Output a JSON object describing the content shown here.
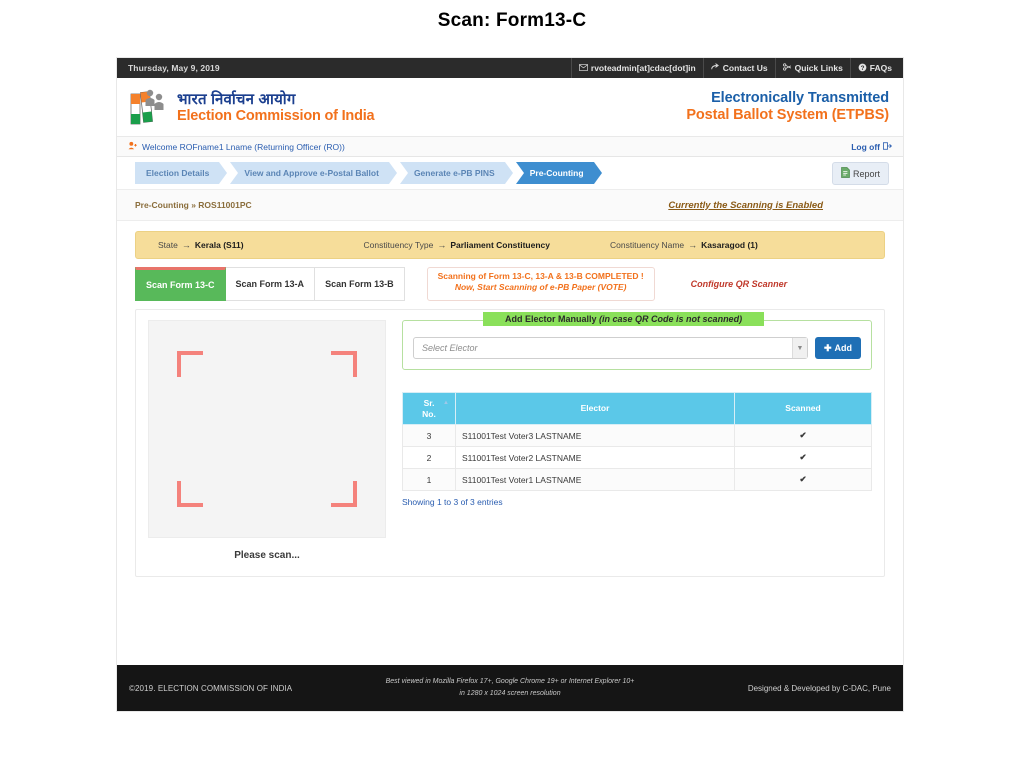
{
  "slide": {
    "title": "Scan: Form13-C"
  },
  "topbar": {
    "date": "Thursday, May 9, 2019",
    "links": [
      {
        "icon": "envelope-icon",
        "glyph": "✉",
        "label": "rvoteadmin[at]cdac[dot]in"
      },
      {
        "icon": "share-icon",
        "glyph": "↱",
        "label": "Contact Us"
      },
      {
        "icon": "link-icon",
        "glyph": "✂",
        "label": "Quick Links"
      },
      {
        "icon": "question-circle-icon",
        "glyph": "@",
        "label": "FAQs"
      }
    ]
  },
  "brand": {
    "hindi": "भारत निर्वाचन आयोग",
    "english": "Election Commission of India",
    "right_line1": "Electronically Transmitted",
    "right_line2": "Postal Ballot System (ETPBS)",
    "logo_icon": "eci-voter-logo-icon"
  },
  "welcome": {
    "user_icon": "user-plus-icon",
    "text": "Welcome ROFname1 Lname (Returning Officer (RO))",
    "logoff_label": "Log off",
    "logoff_icon": "logout-icon"
  },
  "nav": {
    "steps": [
      {
        "label": "Election Details",
        "active": false
      },
      {
        "label": "View and Approve e-Postal Ballot",
        "active": false
      },
      {
        "label": "Generate e-PB PINS",
        "active": false
      },
      {
        "label": "Pre-Counting",
        "active": true
      }
    ],
    "report_label": "Report",
    "report_icon": "document-icon"
  },
  "breadcrumb": {
    "text": "Pre-Counting » ROS11001PC",
    "scan_status": "Currently the Scanning is Enabled"
  },
  "constituency_bar": {
    "state_label": "State",
    "state_value": "Kerala  (S11)",
    "type_label": "Constituency Type",
    "type_value": "Parliament Constituency",
    "name_label": "Constituency Name",
    "name_value": "Kasaragod  (1)",
    "arrow": "→",
    "bg_color": "#f6dd9a"
  },
  "tabs": [
    {
      "label": "Scan Form 13-C",
      "active": true
    },
    {
      "label": "Scan Form 13-A",
      "active": false
    },
    {
      "label": "Scan Form 13-B",
      "active": false
    }
  ],
  "status_message": {
    "line1": "Scanning of Form 13-C, 13-A & 13-B COMPLETED !",
    "line2": "Now, Start Scanning of e-PB Paper (VOTE)",
    "color": "#f2711c"
  },
  "configure_qr": {
    "label": "Configure QR Scanner",
    "color": "#c0392b"
  },
  "scanner": {
    "placeholder_text": "Please scan...",
    "frame_icon": "scan-frame-icon",
    "frame_color": "#f4827c"
  },
  "add_elector": {
    "header_plain": "Add Elector Manually ",
    "header_italic": "(in case QR Code is not scanned)",
    "header_bg": "#8ae05a",
    "select_value": "Select Elector",
    "select_placeholder": "Select Elector",
    "caret_icon": "chevron-down-icon",
    "add_label": "Add",
    "add_icon": "plus-icon",
    "add_color": "#1f6fb5"
  },
  "table": {
    "columns": [
      "Sr. No.",
      "Elector",
      "Scanned"
    ],
    "col_srno_line1": "Sr.",
    "col_srno_line2": "No.",
    "col_elector": "Elector",
    "col_scanned": "Scanned",
    "sort_icon": "sort-asc-icon",
    "header_bg": "#5bc8e8",
    "rows": [
      {
        "sr": "3",
        "elector": "S11001Test Voter3 LASTNAME",
        "scanned": "✔"
      },
      {
        "sr": "2",
        "elector": "S11001Test Voter2 LASTNAME",
        "scanned": "✔"
      },
      {
        "sr": "1",
        "elector": "S11001Test Voter1 LASTNAME",
        "scanned": "✔"
      }
    ],
    "showing": "Showing 1 to 3 of 3 entries"
  },
  "footer": {
    "left": "©2019. ELECTION COMMISSION OF INDIA",
    "middle_line1": "Best viewed in Mozilla Firefox 17+, Google Chrome 19+ or Internet Explorer 10+",
    "middle_line2": "in 1280 x 1024 screen resolution",
    "right": "Designed & Developed by C-DAC, Pune"
  }
}
